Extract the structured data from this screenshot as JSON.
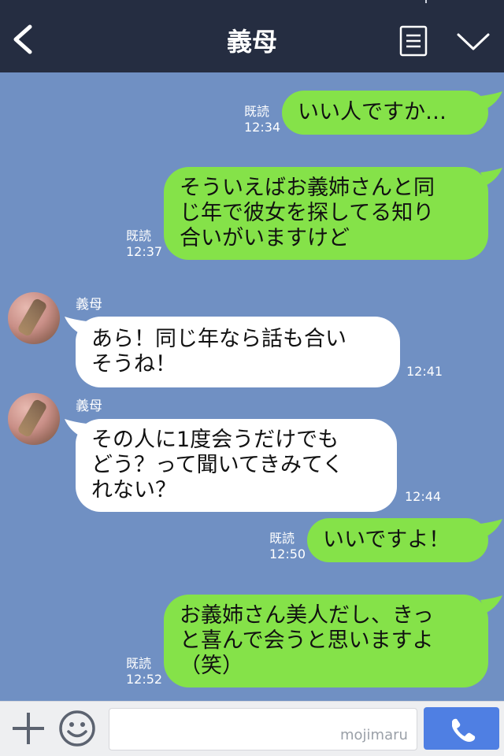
{
  "header": {
    "back_icon": "chevron-left-icon",
    "title": "義母",
    "menu_icon": "menu-icon",
    "dropdown_icon": "chevron-down-icon"
  },
  "messages": [
    {
      "direction": "out",
      "text": "いい人ですか…",
      "read": "既読",
      "time": "12:34"
    },
    {
      "direction": "out",
      "text": "そういえばお義姉さんと同\nじ年で彼女を探してる知り\n合いがいますけど",
      "read": "既読",
      "time": "12:37"
    },
    {
      "direction": "in",
      "sender": "義母",
      "text": "あら！同じ年なら話も合い\nそうね！",
      "time": "12:41"
    },
    {
      "direction": "in",
      "sender": "義母",
      "text": "その人に1度会うだけでも\nどう？って聞いてきみてく\nれない？",
      "time": "12:44"
    },
    {
      "direction": "out",
      "text": "いいですよ！",
      "read": "既読",
      "time": "12:50"
    },
    {
      "direction": "out",
      "text": "お義姉さん美人だし、きっ\nと喜んで会うと思いますよ\n（笑）",
      "read": "既読",
      "time": "12:52"
    }
  ],
  "footer": {
    "plus_icon": "plus-icon",
    "emoji_icon": "smiley-icon",
    "input_value": "",
    "watermark": "mojimaru",
    "call_icon": "phone-icon"
  },
  "colors": {
    "header_bg": "#252d41",
    "chat_bg": "#7090c3",
    "outgoing_bubble": "#85e249",
    "incoming_bubble": "#ffffff",
    "call_button": "#4f7fe3"
  }
}
